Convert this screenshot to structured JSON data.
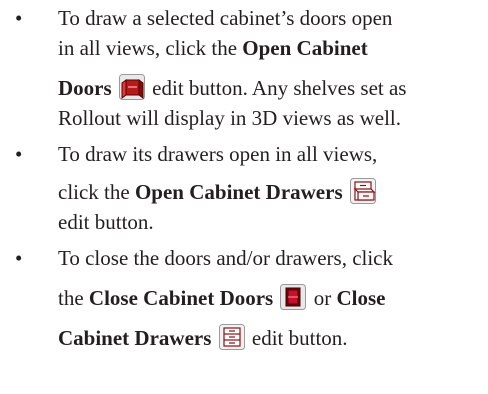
{
  "bullets": [
    {
      "symbol": "•",
      "line1": "To draw a selected cabinet’s doors open",
      "line2_pre": "in all views, click the ",
      "line2_bold": "Open Cabinet",
      "line3_bold": "Doors",
      "line3_post": " edit button. Any shelves set as",
      "line4": "Rollout will display in 3D views as well.",
      "icon": "open-cabinet-doors-icon"
    },
    {
      "symbol": "•",
      "line1": "To draw its drawers open in all views,",
      "line2_pre": "click the ",
      "line2_bold": "Open Cabinet Drawers",
      "line3": "edit button.",
      "icon": "open-cabinet-drawers-icon"
    },
    {
      "symbol": "•",
      "line1": "To close the doors and/or drawers, click",
      "line2_pre": "the ",
      "line2_bold": "Close Cabinet Doors",
      "line2_mid": " or ",
      "line2_bold2": "Close",
      "line3_bold": "Cabinet Drawers",
      "line3_post": " edit button.",
      "icons": [
        "close-cabinet-doors-icon",
        "close-cabinet-drawers-icon"
      ]
    }
  ],
  "colors": {
    "text": "#231f20",
    "icon_red": "#c8102e",
    "icon_gray": "#8a8a8a"
  }
}
